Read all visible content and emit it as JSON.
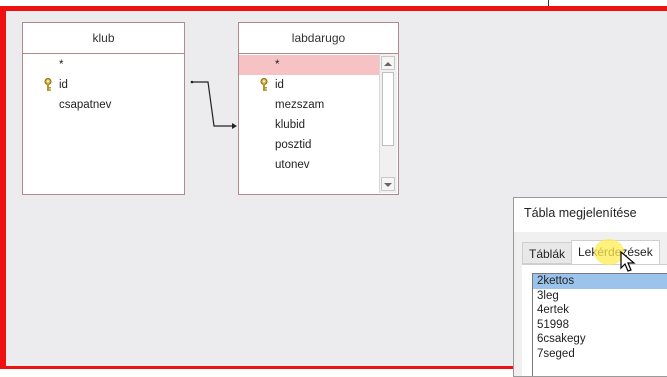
{
  "tables": {
    "klub": {
      "title": "klub",
      "fields": [
        "*",
        "id",
        "csapatnev"
      ]
    },
    "labdarugo": {
      "title": "labdarugo",
      "fields": [
        "*",
        "id",
        "mezszam",
        "klubid",
        "posztid",
        "utonev"
      ]
    }
  },
  "dialog": {
    "title": "Tábla megjelenítése",
    "tabs": [
      "Táblák",
      "Lekérdezések"
    ],
    "active_tab": "Lekérdezések",
    "queries": [
      "2kettos",
      "3leg",
      "4ertek",
      "51998",
      "6csakegy",
      "7seged"
    ],
    "selected_query": "2kettos"
  },
  "colors": {
    "frame": "#ee1111",
    "table_border": "#b28a8e",
    "selected_field": "#f7c2c4",
    "selected_list_item": "#9cc3eb"
  }
}
